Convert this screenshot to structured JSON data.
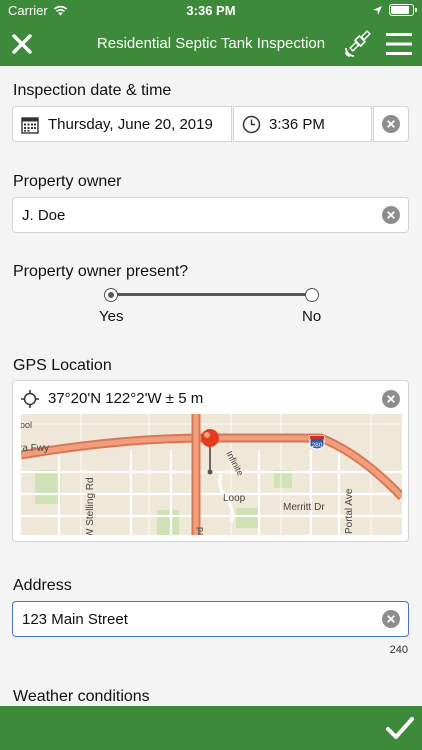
{
  "status_bar": {
    "carrier": "Carrier",
    "time": "3:36 PM",
    "battery_level": 0.85
  },
  "nav": {
    "title": "Residential Septic Tank Inspection"
  },
  "inspection": {
    "label": "Inspection date & time",
    "date": "Thursday, June 20, 2019",
    "time": "3:36 PM"
  },
  "owner": {
    "label": "Property owner",
    "value": "J. Doe"
  },
  "owner_present": {
    "label": "Property owner present?",
    "options": [
      "Yes",
      "No"
    ],
    "selected": "Yes"
  },
  "gps": {
    "label": "GPS Location",
    "value": "37°20'N 122°2'W ± 5 m",
    "map": {
      "streets": [
        "ra Fwy",
        "W Stelling Rd",
        "Merritt Dr",
        "Portal Ave",
        "Loop",
        "Infinite",
        "rd",
        "hool"
      ],
      "shield": "280"
    }
  },
  "address": {
    "label": "Address",
    "value": "123 Main Street",
    "remaining": "240"
  },
  "weather": {
    "label": "Weather conditions"
  },
  "colors": {
    "brand_green": "#3c8a3a",
    "focus_blue": "#4a74c9",
    "pin_red": "#e23d1f"
  }
}
